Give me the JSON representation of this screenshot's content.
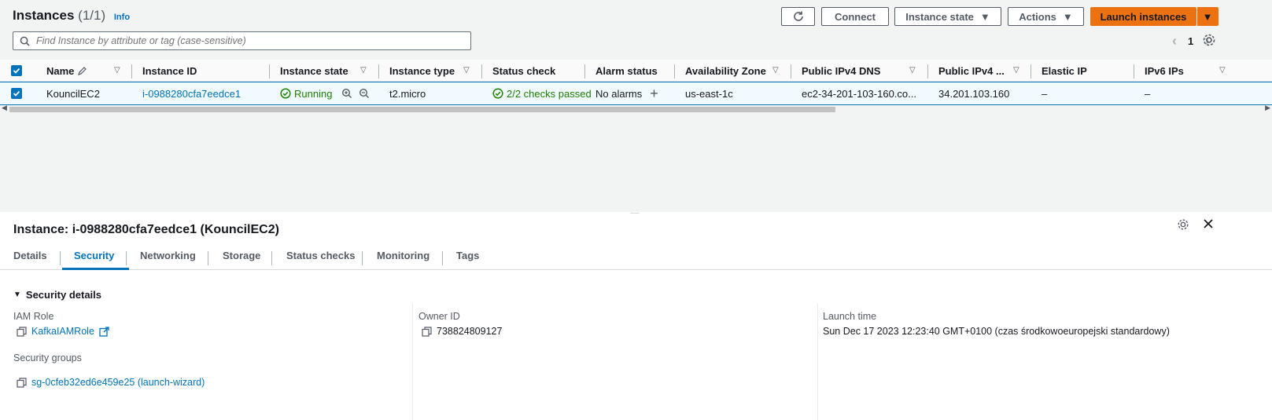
{
  "header": {
    "title": "Instances",
    "count": "(1/1)",
    "info": "Info",
    "buttons": {
      "connect": "Connect",
      "instance_state": "Instance state",
      "actions": "Actions",
      "launch": "Launch instances"
    }
  },
  "search": {
    "placeholder": "Find Instance by attribute or tag (case-sensitive)"
  },
  "pagination": {
    "page": "1"
  },
  "table": {
    "columns": [
      "Name",
      "Instance ID",
      "Instance state",
      "Instance type",
      "Status check",
      "Alarm status",
      "Availability Zone",
      "Public IPv4 DNS",
      "Public IPv4 ...",
      "Elastic IP",
      "IPv6 IPs"
    ],
    "row": {
      "name": "KouncilEC2",
      "instance_id": "i-0988280cfa7eedce1",
      "state": "Running",
      "type": "t2.micro",
      "status_check": "2/2 checks passed",
      "alarm_status": "No alarms",
      "az": "us-east-1c",
      "dns": "ec2-34-201-103-160.co...",
      "ipv4": "34.201.103.160",
      "elastic_ip": "–",
      "ipv6": "–"
    }
  },
  "detail": {
    "title": "Instance: i-0988280cfa7eedce1 (KouncilEC2)",
    "tabs": [
      "Details",
      "Security",
      "Networking",
      "Storage",
      "Status checks",
      "Monitoring",
      "Tags"
    ],
    "active_tab": "Security",
    "section_title": "Security details",
    "iam_role_label": "IAM Role",
    "iam_role_value": "KafkaIAMRole",
    "owner_id_label": "Owner ID",
    "owner_id_value": "738824809127",
    "launch_time_label": "Launch time",
    "launch_time_value": "Sun Dec 17 2023 12:23:40 GMT+0100 (czas środkowoeuropejski standardowy)",
    "security_groups_label": "Security groups",
    "security_groups_value": "sg-0cfeb32ed6e459e25 (launch-wizard)"
  },
  "colors": {
    "accent": "#0073bb",
    "brand": "#ec7211",
    "success": "#1d8102"
  }
}
